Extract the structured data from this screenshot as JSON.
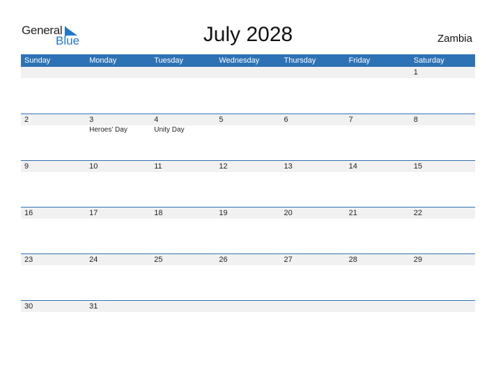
{
  "logo": {
    "general": "General",
    "blue": "Blue"
  },
  "title": "July 2028",
  "country": "Zambia",
  "weekdays": [
    "Sunday",
    "Monday",
    "Tuesday",
    "Wednesday",
    "Thursday",
    "Friday",
    "Saturday"
  ],
  "weeks": [
    [
      {
        "d": ""
      },
      {
        "d": ""
      },
      {
        "d": ""
      },
      {
        "d": ""
      },
      {
        "d": ""
      },
      {
        "d": ""
      },
      {
        "d": "1"
      }
    ],
    [
      {
        "d": "2"
      },
      {
        "d": "3",
        "h": "Heroes' Day"
      },
      {
        "d": "4",
        "h": "Unity Day"
      },
      {
        "d": "5"
      },
      {
        "d": "6"
      },
      {
        "d": "7"
      },
      {
        "d": "8"
      }
    ],
    [
      {
        "d": "9"
      },
      {
        "d": "10"
      },
      {
        "d": "11"
      },
      {
        "d": "12"
      },
      {
        "d": "13"
      },
      {
        "d": "14"
      },
      {
        "d": "15"
      }
    ],
    [
      {
        "d": "16"
      },
      {
        "d": "17"
      },
      {
        "d": "18"
      },
      {
        "d": "19"
      },
      {
        "d": "20"
      },
      {
        "d": "21"
      },
      {
        "d": "22"
      }
    ],
    [
      {
        "d": "23"
      },
      {
        "d": "24"
      },
      {
        "d": "25"
      },
      {
        "d": "26"
      },
      {
        "d": "27"
      },
      {
        "d": "28"
      },
      {
        "d": "29"
      }
    ],
    [
      {
        "d": "30"
      },
      {
        "d": "31"
      },
      {
        "d": ""
      },
      {
        "d": ""
      },
      {
        "d": ""
      },
      {
        "d": ""
      },
      {
        "d": ""
      }
    ]
  ],
  "colors": {
    "accent": "#2e72b6",
    "band": "#f1f1f1",
    "logo_blue": "#1f77c9"
  }
}
